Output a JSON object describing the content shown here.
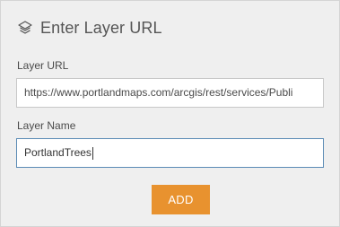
{
  "header": {
    "icon": "layers-icon",
    "title": "Enter Layer URL"
  },
  "form": {
    "url_label": "Layer URL",
    "url_value": "https://www.portlandmaps.com/arcgis/rest/services/Publi",
    "name_label": "Layer Name",
    "name_value": "PortlandTrees"
  },
  "actions": {
    "add_label": "ADD"
  },
  "colors": {
    "panel_bg": "#efefef",
    "accent": "#e8922f",
    "focus_border": "#5b8bb5"
  }
}
